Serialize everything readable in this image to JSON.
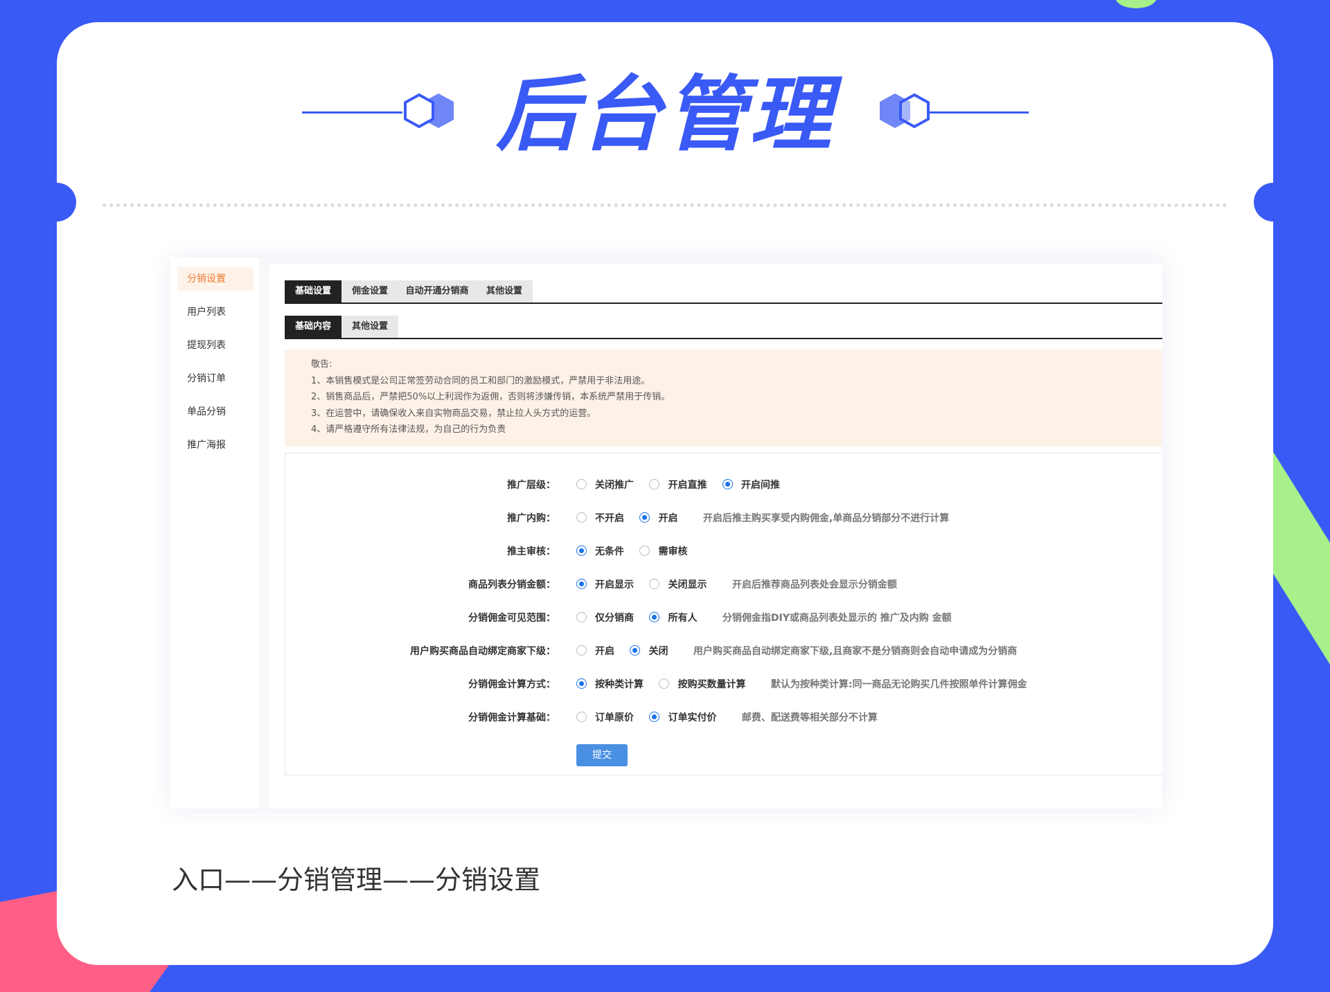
{
  "hero": {
    "title": "后台管理"
  },
  "sidebar": {
    "items": [
      {
        "label": "分销设置",
        "active": true
      },
      {
        "label": "用户列表",
        "active": false
      },
      {
        "label": "提现列表",
        "active": false
      },
      {
        "label": "分销订单",
        "active": false
      },
      {
        "label": "单品分销",
        "active": false
      },
      {
        "label": "推广海报",
        "active": false
      }
    ]
  },
  "tabs_primary": [
    "基础设置",
    "佣金设置",
    "自动开通分销商",
    "其他设置"
  ],
  "tabs_secondary": [
    "基础内容",
    "其他设置"
  ],
  "notice": {
    "title": "敬告:",
    "lines": [
      "1、本销售模式是公司正常签劳动合同的员工和部门的激励模式，严禁用于非法用途。",
      "2、销售商品后，严禁把50%以上利润作为返佣，否则将涉嫌传销，本系统严禁用于传销。",
      "3、在运营中，请确保收入来自实物商品交易，禁止拉人头方式的运营。",
      "4、请严格遵守所有法律法规，为自己的行为负责"
    ]
  },
  "form": {
    "rows": [
      {
        "label": "推广层级：",
        "options": [
          {
            "text": "关闭推广",
            "checked": false
          },
          {
            "text": "开启直推",
            "checked": false
          },
          {
            "text": "开启间推",
            "checked": true
          }
        ],
        "hint": ""
      },
      {
        "label": "推广内购：",
        "options": [
          {
            "text": "不开启",
            "checked": false
          },
          {
            "text": "开启",
            "checked": true
          }
        ],
        "hint": "开启后推主购买享受内购佣金,单商品分销部分不进行计算"
      },
      {
        "label": "推主审核：",
        "options": [
          {
            "text": "无条件",
            "checked": true
          },
          {
            "text": "需审核",
            "checked": false
          }
        ],
        "hint": ""
      },
      {
        "label": "商品列表分销金额：",
        "options": [
          {
            "text": "开启显示",
            "checked": true
          },
          {
            "text": "关闭显示",
            "checked": false
          }
        ],
        "hint": "开启后推荐商品列表处会显示分销金额"
      },
      {
        "label": "分销佣金可见范围：",
        "options": [
          {
            "text": "仅分销商",
            "checked": false
          },
          {
            "text": "所有人",
            "checked": true
          }
        ],
        "hint": "分销佣金指DIY或商品列表处显示的 推广及内购 金额"
      },
      {
        "label": "用户购买商品自动绑定商家下级：",
        "options": [
          {
            "text": "开启",
            "checked": false
          },
          {
            "text": "关闭",
            "checked": true
          }
        ],
        "hint": "用户购买商品自动绑定商家下级,且商家不是分销商则会自动申请成为分销商"
      },
      {
        "label": "分销佣金计算方式：",
        "options": [
          {
            "text": "按种类计算",
            "checked": true
          },
          {
            "text": "按购买数量计算",
            "checked": false
          }
        ],
        "hint": "默认为按种类计算:同一商品无论购买几件按照单件计算佣金"
      },
      {
        "label": "分销佣金计算基础：",
        "options": [
          {
            "text": "订单原价",
            "checked": false
          },
          {
            "text": "订单实付价",
            "checked": true
          }
        ],
        "hint": "邮费、配送费等相关部分不计算"
      }
    ],
    "submit_label": "提交"
  },
  "entry_caption": "入口——分销管理——分销设置",
  "colors": {
    "brand_blue": "#3a5af5",
    "accent_orange": "#f07b2f",
    "radio_blue": "#1a73e8",
    "submit_blue": "#4a90e2"
  },
  "icons": [
    "hexagon-pair-icon"
  ]
}
